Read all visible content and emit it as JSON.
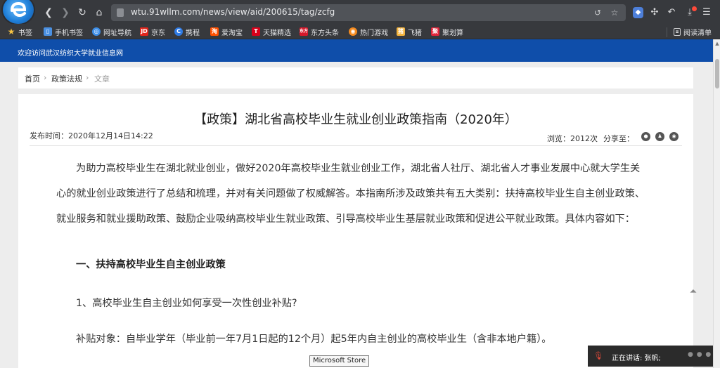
{
  "browser": {
    "url": "wtu.91wllm.com/news/view/aid/200615/tag/zcfg",
    "bookmarks": [
      {
        "label": "书签",
        "icon": "star-icon",
        "color": "#f6c343"
      },
      {
        "label": "手机书签",
        "icon": "phone-icon",
        "color": "#4a90e2"
      },
      {
        "label": "网址导航",
        "icon": "globe-icon",
        "color": "#3d8ee8"
      },
      {
        "label": "京东",
        "icon": "jd-icon",
        "color": "#e1251b"
      },
      {
        "label": "携程",
        "icon": "ctrip-icon",
        "color": "#2f7be5"
      },
      {
        "label": "爱淘宝",
        "icon": "taobao-icon",
        "color": "#ff5000"
      },
      {
        "label": "天猫精选",
        "icon": "tmall-icon",
        "color": "#d8001a"
      },
      {
        "label": "东方头条",
        "icon": "toutiao-icon",
        "color": "#d6182a"
      },
      {
        "label": "热门游戏",
        "icon": "game-icon",
        "color": "#f58b1f"
      },
      {
        "label": "飞猪",
        "icon": "fliggy-icon",
        "color": "#f3b33d"
      },
      {
        "label": "聚划算",
        "icon": "juhuasuan-icon",
        "color": "#e0253a"
      }
    ],
    "reading_list_label": "阅读清单",
    "accent_color": "#0f4eaa"
  },
  "site": {
    "welcome_text": "欢迎访问武汉纺织大学就业信息网"
  },
  "breadcrumb": {
    "home": "首页",
    "section": "政策法规",
    "current": "文章"
  },
  "article": {
    "title": "【政策】湖北省高校毕业生就业创业政策指南（2020年）",
    "publish_time": "发布时间：2020年12月14日14:22",
    "views": "浏览：2012次",
    "share_label": "分享至：",
    "intro_lines": [
      "为助力高校毕业生在湖北就业创业，做好2020年高校毕业生就业创业工作，湖北省人社厅、湖北省人才事业发展中心就大学生关",
      "心的就业创业政策进行了总结和梳理，并对有关问题做了权威解答。本指南所涉及政策共有五大类别：扶持高校毕业生自主创业政策、",
      "就业服务和就业援助政策、鼓励企业吸纳高校毕业生就业政策、引导高校毕业生基层就业政策和促进公平就业政策。具体内容如下："
    ],
    "section_heading": "一、扶持高校毕业生自主创业政策",
    "question_1": "1、高校毕业生自主创业如何享受一次性创业补贴?",
    "subsidy_target": "补贴对象：自毕业学年（毕业前一年7月1日起的12个月）起5年内自主创业的高校毕业生（含非本地户籍）。"
  },
  "tooltip": {
    "text": "Microsoft Store"
  },
  "speaking": {
    "text": "正在讲话: 张帆;"
  }
}
